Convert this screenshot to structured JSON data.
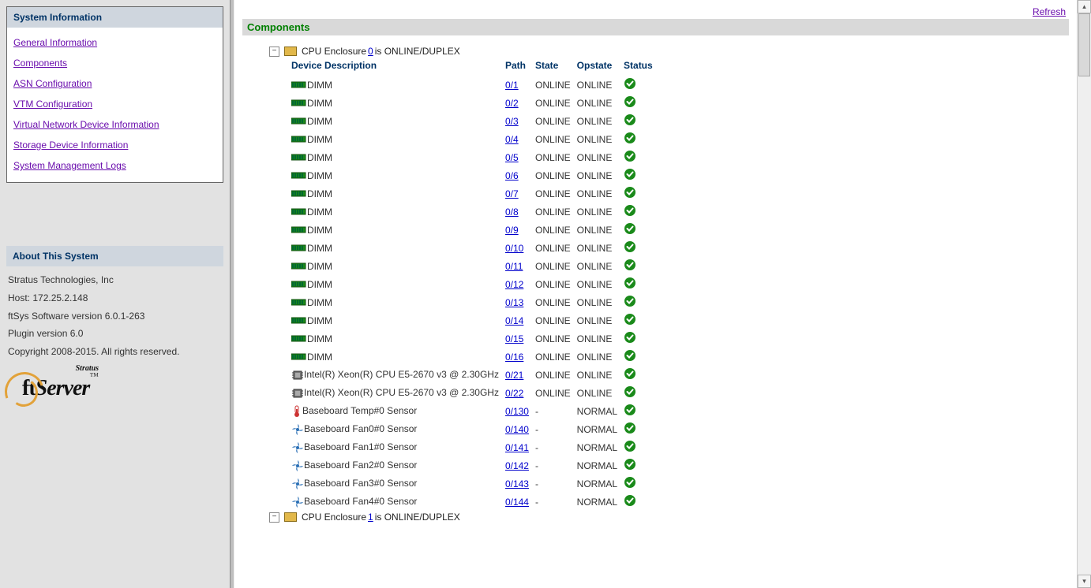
{
  "sidebar": {
    "title": "System Information",
    "items": [
      {
        "label": "General Information"
      },
      {
        "label": "Components"
      },
      {
        "label": "ASN Configuration"
      },
      {
        "label": "VTM Configuration"
      },
      {
        "label": "Virtual Network Device Information"
      },
      {
        "label": "Storage Device Information"
      },
      {
        "label": "System Management Logs"
      }
    ]
  },
  "about": {
    "title": "About This System",
    "company": "Stratus Technologies, Inc",
    "host_label": "Host: 172.25.2.148",
    "ftsys": "ftSys Software version 6.0.1-263",
    "plugin": "Plugin version 6.0",
    "copyright": "Copyright 2008-2015. All rights reserved.",
    "logo_brand": "Stratus",
    "logo_ft": "ft",
    "logo_server": "Server",
    "logo_tm": "™"
  },
  "main": {
    "refresh": "Refresh",
    "section_title": "Components",
    "headers": {
      "device": "Device Description",
      "path": "Path",
      "state": "State",
      "opstate": "Opstate",
      "status": "Status"
    },
    "enclosures": [
      {
        "prefix": "CPU Enclosure ",
        "id": "0",
        "suffix": " is ONLINE/DUPLEX",
        "expanded": true,
        "devices": [
          {
            "icon": "dimm",
            "desc": "DIMM",
            "path": "0/1",
            "state": "ONLINE",
            "opstate": "ONLINE",
            "status": "ok"
          },
          {
            "icon": "dimm",
            "desc": "DIMM",
            "path": "0/2",
            "state": "ONLINE",
            "opstate": "ONLINE",
            "status": "ok"
          },
          {
            "icon": "dimm",
            "desc": "DIMM",
            "path": "0/3",
            "state": "ONLINE",
            "opstate": "ONLINE",
            "status": "ok"
          },
          {
            "icon": "dimm",
            "desc": "DIMM",
            "path": "0/4",
            "state": "ONLINE",
            "opstate": "ONLINE",
            "status": "ok"
          },
          {
            "icon": "dimm",
            "desc": "DIMM",
            "path": "0/5",
            "state": "ONLINE",
            "opstate": "ONLINE",
            "status": "ok"
          },
          {
            "icon": "dimm",
            "desc": "DIMM",
            "path": "0/6",
            "state": "ONLINE",
            "opstate": "ONLINE",
            "status": "ok"
          },
          {
            "icon": "dimm",
            "desc": "DIMM",
            "path": "0/7",
            "state": "ONLINE",
            "opstate": "ONLINE",
            "status": "ok"
          },
          {
            "icon": "dimm",
            "desc": "DIMM",
            "path": "0/8",
            "state": "ONLINE",
            "opstate": "ONLINE",
            "status": "ok"
          },
          {
            "icon": "dimm",
            "desc": "DIMM",
            "path": "0/9",
            "state": "ONLINE",
            "opstate": "ONLINE",
            "status": "ok"
          },
          {
            "icon": "dimm",
            "desc": "DIMM",
            "path": "0/10",
            "state": "ONLINE",
            "opstate": "ONLINE",
            "status": "ok"
          },
          {
            "icon": "dimm",
            "desc": "DIMM",
            "path": "0/11",
            "state": "ONLINE",
            "opstate": "ONLINE",
            "status": "ok"
          },
          {
            "icon": "dimm",
            "desc": "DIMM",
            "path": "0/12",
            "state": "ONLINE",
            "opstate": "ONLINE",
            "status": "ok"
          },
          {
            "icon": "dimm",
            "desc": "DIMM",
            "path": "0/13",
            "state": "ONLINE",
            "opstate": "ONLINE",
            "status": "ok"
          },
          {
            "icon": "dimm",
            "desc": "DIMM",
            "path": "0/14",
            "state": "ONLINE",
            "opstate": "ONLINE",
            "status": "ok"
          },
          {
            "icon": "dimm",
            "desc": "DIMM",
            "path": "0/15",
            "state": "ONLINE",
            "opstate": "ONLINE",
            "status": "ok"
          },
          {
            "icon": "dimm",
            "desc": "DIMM",
            "path": "0/16",
            "state": "ONLINE",
            "opstate": "ONLINE",
            "status": "ok"
          },
          {
            "icon": "cpu",
            "desc": "Intel(R) Xeon(R) CPU E5-2670 v3 @ 2.30GHz",
            "path": "0/21",
            "state": "ONLINE",
            "opstate": "ONLINE",
            "status": "ok"
          },
          {
            "icon": "cpu",
            "desc": "Intel(R) Xeon(R) CPU E5-2670 v3 @ 2.30GHz",
            "path": "0/22",
            "state": "ONLINE",
            "opstate": "ONLINE",
            "status": "ok"
          },
          {
            "icon": "temp",
            "desc": "Baseboard Temp#0 Sensor",
            "path": "0/130",
            "state": "-",
            "opstate": "NORMAL",
            "status": "ok"
          },
          {
            "icon": "fan",
            "desc": "Baseboard Fan0#0 Sensor",
            "path": "0/140",
            "state": "-",
            "opstate": "NORMAL",
            "status": "ok"
          },
          {
            "icon": "fan",
            "desc": "Baseboard Fan1#0 Sensor",
            "path": "0/141",
            "state": "-",
            "opstate": "NORMAL",
            "status": "ok"
          },
          {
            "icon": "fan",
            "desc": "Baseboard Fan2#0 Sensor",
            "path": "0/142",
            "state": "-",
            "opstate": "NORMAL",
            "status": "ok"
          },
          {
            "icon": "fan",
            "desc": "Baseboard Fan3#0 Sensor",
            "path": "0/143",
            "state": "-",
            "opstate": "NORMAL",
            "status": "ok"
          },
          {
            "icon": "fan",
            "desc": "Baseboard Fan4#0 Sensor",
            "path": "0/144",
            "state": "-",
            "opstate": "NORMAL",
            "status": "ok"
          }
        ]
      },
      {
        "prefix": "CPU Enclosure ",
        "id": "1",
        "suffix": " is ONLINE/DUPLEX",
        "expanded": true,
        "devices": []
      }
    ]
  }
}
